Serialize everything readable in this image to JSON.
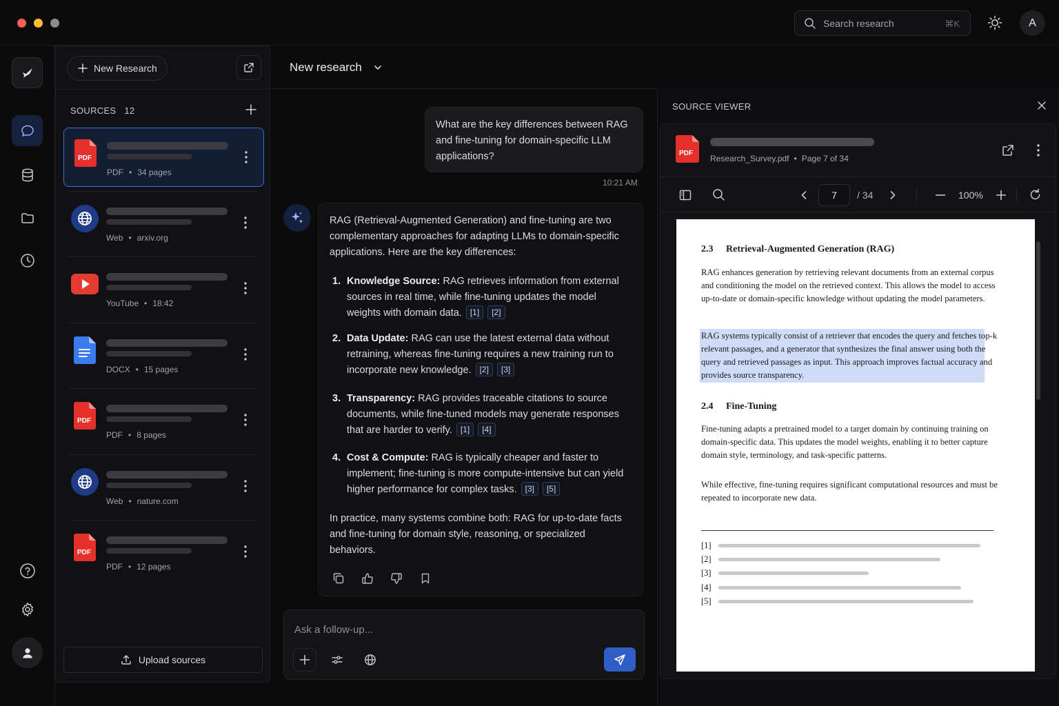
{
  "titlebar": {
    "traffic_colors": [
      "#ff5f57",
      "#febc2e",
      "#8a8a90"
    ],
    "search_placeholder": "Search research",
    "search_shortcut": "⌘K",
    "avatar_initial": "A"
  },
  "rail": {
    "items": [
      "logo-icon",
      "chat-icon",
      "database-icon",
      "folder-icon",
      "history-icon",
      "help-icon",
      "settings-icon",
      "profile-icon"
    ]
  },
  "sources_panel": {
    "new_button": "New Research",
    "header_label": "SOURCES",
    "count": "12",
    "items": [
      {
        "type": "pdf",
        "kind": "PDF",
        "detail": "34 pages",
        "selected": true
      },
      {
        "type": "web",
        "kind": "Web",
        "detail": "arxiv.org"
      },
      {
        "type": "youtube",
        "kind": "YouTube",
        "detail": "18:42"
      },
      {
        "type": "docx",
        "kind": "DOCX",
        "detail": "15 pages"
      },
      {
        "type": "pdf",
        "kind": "PDF",
        "detail": "8 pages"
      },
      {
        "type": "web",
        "kind": "Web",
        "detail": "nature.com"
      },
      {
        "type": "pdf",
        "kind": "PDF",
        "detail": "12 pages"
      }
    ],
    "upload_button": "Upload sources",
    "pdf_label": "PDF"
  },
  "chat": {
    "title": "New research",
    "user_message": "What are the key differences between RAG and fine-tuning for domain-specific LLM applications?",
    "user_time": "10:21 AM",
    "ai_intro": "RAG (Retrieval-Augmented Generation) and fine-tuning are two complementary approaches for adapting LLMs to domain-specific applications. Here are the key differences:",
    "points": [
      {
        "num": "1.",
        "title": "Knowledge Source:",
        "text": "RAG retrieves information from external sources in real time, while fine-tuning updates the model weights with domain data.",
        "cites": [
          "[1]",
          "[2]"
        ]
      },
      {
        "num": "2.",
        "title": "Data Update:",
        "text": "RAG can use the latest external data without retraining, whereas fine-tuning requires a new training run to incorporate new knowledge.",
        "cites": [
          "[2]",
          "[3]"
        ]
      },
      {
        "num": "3.",
        "title": "Transparency:",
        "text": "RAG provides traceable citations to source documents, while fine-tuned models may generate responses that are harder to verify.",
        "cites": [
          "[1]",
          "[4]"
        ]
      },
      {
        "num": "4.",
        "title": "Cost & Compute:",
        "text": "RAG is typically cheaper and faster to implement; fine-tuning is more compute-intensive but can yield higher performance for complex tasks.",
        "cites": [
          "[3]",
          "[5]"
        ]
      }
    ],
    "ai_outro": "In practice, many systems combine both: RAG for up-to-date facts and fine-tuning for domain style, reasoning, or specialized behaviors.",
    "composer_placeholder": "Ask a follow-up..."
  },
  "viewer": {
    "title": "SOURCE VIEWER",
    "file_name": "Research_Survey.pdf",
    "page_label": "Page 7 of 34",
    "page_current": "7",
    "page_total": "/ 34",
    "zoom": "100%",
    "doc": {
      "sec1_num": "2.3",
      "sec1_title": "Retrieval-Augmented Generation (RAG)",
      "para1": "RAG enhances generation by retrieving relevant documents from an external corpus and conditioning the model on the retrieved context. This allows the model to access up-to-date or domain-specific knowledge without updating the model parameters.",
      "para2": "RAG systems typically consist of a retriever that encodes the query and fetches top-k relevant passages, and a generator that synthesizes the final answer using both the query and retrieved passages as input. This approach improves factual accuracy and provides source transparency.",
      "sec2_num": "2.4",
      "sec2_title": "Fine-Tuning",
      "para3": "Fine-tuning adapts a pretrained model to a target domain by continuing training on domain-specific data. This updates the model weights, enabling it to better capture domain style, terminology, and task-specific patterns.",
      "para4": "While effective, fine-tuning requires significant computational resources and must be repeated to incorporate new data.",
      "refs": [
        "[1]",
        "[2]",
        "[3]",
        "[4]",
        "[5]"
      ]
    }
  }
}
